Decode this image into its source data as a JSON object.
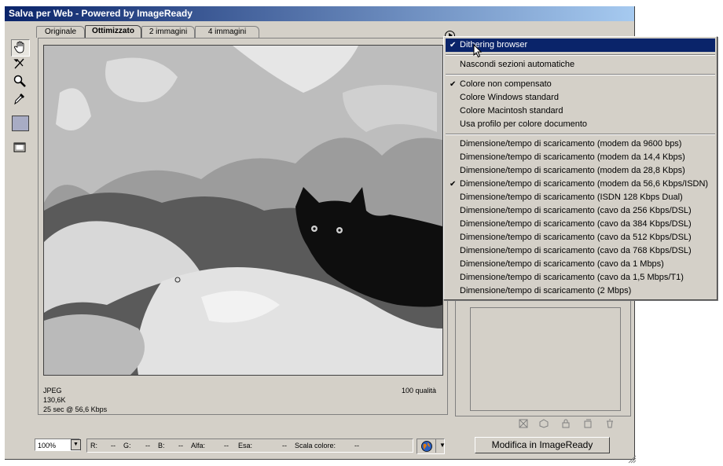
{
  "window": {
    "title": "Salva per Web - Powered by ImageReady"
  },
  "tabs": [
    {
      "label": "Originale",
      "active": false
    },
    {
      "label": "Ottimizzato",
      "active": true
    },
    {
      "label": "2 immagini",
      "active": false
    },
    {
      "label": "4 immagini",
      "active": false
    }
  ],
  "tools": [
    {
      "icon": "hand-icon"
    },
    {
      "icon": "slice-select-icon"
    },
    {
      "icon": "zoom-icon"
    },
    {
      "icon": "eyedropper-icon"
    },
    {
      "icon": "eyedropper-color-icon"
    },
    {
      "icon": "toggle-slices-icon"
    }
  ],
  "image_info": {
    "format": "JPEG",
    "size": "130,6K",
    "time": "25 sec @ 56,6 Kbps",
    "quality": "100 qualità"
  },
  "menu": {
    "items": [
      {
        "label": "Dithering browser",
        "checked": true,
        "selected": true
      },
      {
        "sep": true
      },
      {
        "label": "Nascondi sezioni automatiche",
        "checked": false
      },
      {
        "sep": true
      },
      {
        "label": "Colore non compensato",
        "checked": true
      },
      {
        "label": "Colore Windows standard",
        "checked": false
      },
      {
        "label": "Colore Macintosh standard",
        "checked": false
      },
      {
        "label": "Usa profilo per colore documento",
        "checked": false
      },
      {
        "sep": true
      },
      {
        "label": "Dimensione/tempo di scaricamento (modem da 9600 bps)",
        "checked": false
      },
      {
        "label": "Dimensione/tempo di scaricamento (modem da 14,4 Kbps)",
        "checked": false
      },
      {
        "label": "Dimensione/tempo di scaricamento (modem da 28,8 Kbps)",
        "checked": false
      },
      {
        "label": "Dimensione/tempo di scaricamento (modem da 56,6 Kbps/ISDN)",
        "checked": true
      },
      {
        "label": "Dimensione/tempo di scaricamento (ISDN 128 Kbps Dual)",
        "checked": false
      },
      {
        "label": "Dimensione/tempo di scaricamento (cavo da 256 Kbps/DSL)",
        "checked": false
      },
      {
        "label": "Dimensione/tempo di scaricamento (cavo da 384 Kbps/DSL)",
        "checked": false
      },
      {
        "label": "Dimensione/tempo di scaricamento (cavo da 512 Kbps/DSL)",
        "checked": false
      },
      {
        "label": "Dimensione/tempo di scaricamento (cavo da 768 Kbps/DSL)",
        "checked": false
      },
      {
        "label": "Dimensione/tempo di scaricamento (cavo da 1 Mbps)",
        "checked": false
      },
      {
        "label": "Dimensione/tempo di scaricamento (cavo da 1,5 Mbps/T1)",
        "checked": false
      },
      {
        "label": "Dimensione/tempo di scaricamento (2 Mbps)",
        "checked": false
      }
    ]
  },
  "status": {
    "zoom": "100%",
    "readout": {
      "r": "R:",
      "r_val": "--",
      "g": "G:",
      "g_val": "--",
      "b": "B:",
      "b_val": "--",
      "alpha": "Alfa:",
      "alpha_val": "--",
      "hex": "Esa:",
      "hex_val": "--",
      "index": "Scala colore:",
      "index_val": "--"
    },
    "edit_button": "Modifica in ImageReady"
  },
  "colors": {
    "title_start": "#0a246a",
    "title_end": "#a6caf0",
    "face": "#d4d0c8",
    "highlight": "#0a246a"
  }
}
